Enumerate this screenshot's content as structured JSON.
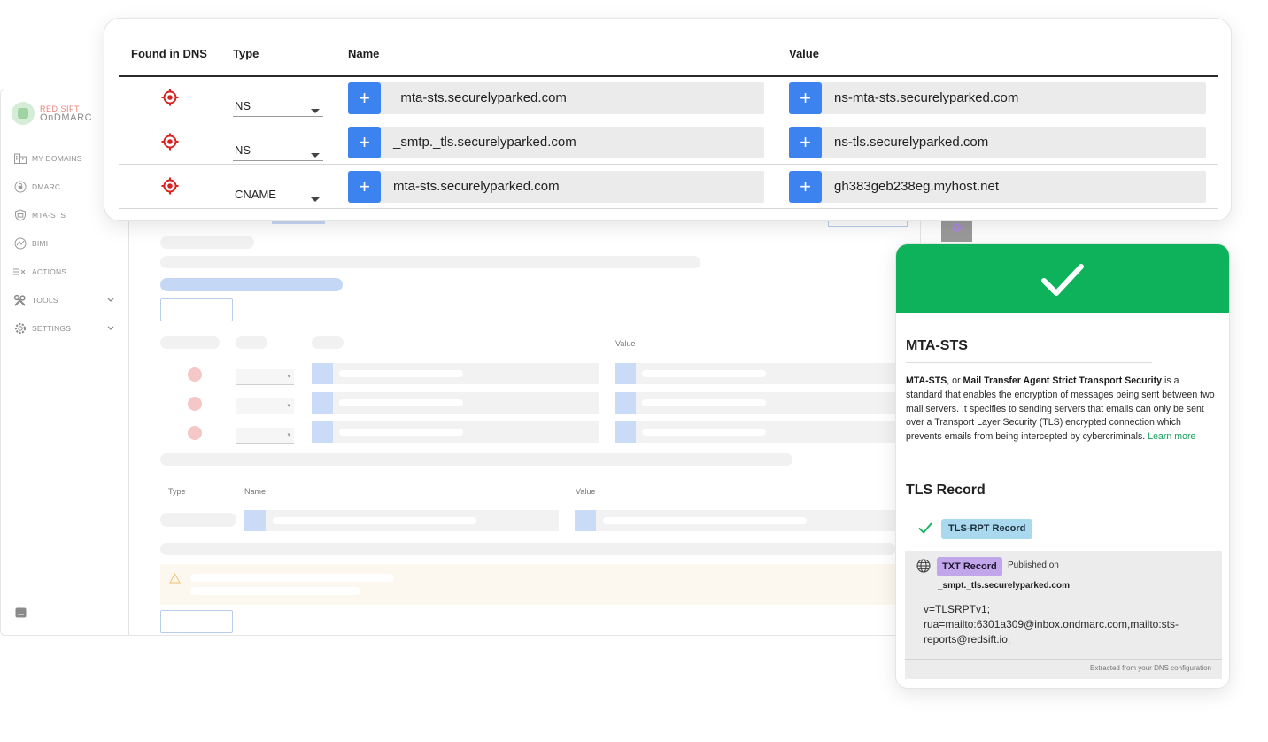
{
  "app": {
    "logo": {
      "line1": "RED SIFT",
      "line2": "OnDMARC"
    },
    "nav": [
      {
        "label": "MY DOMAINS",
        "icon": "building-icon"
      },
      {
        "label": "DMARC",
        "icon": "shield-lock-icon"
      },
      {
        "label": "MTA-STS",
        "icon": "shield-mail-icon"
      },
      {
        "label": "BIMI",
        "icon": "bimi-icon"
      },
      {
        "label": "ACTIONS",
        "icon": "actions-icon"
      },
      {
        "label": "TOOLS",
        "icon": "tools-icon"
      },
      {
        "label": "SETTINGS",
        "icon": "gear-icon"
      }
    ],
    "bg_table1": {
      "value_header": "Value"
    },
    "bg_table2": {
      "type_header": "Type",
      "name_header": "Name",
      "value_header": "Value"
    }
  },
  "dns": {
    "headers": {
      "found": "Found in DNS",
      "type": "Type",
      "name": "Name",
      "value": "Value"
    },
    "rows": [
      {
        "type": "NS",
        "name": "_mta-sts.securelyparked.com",
        "value": "ns-mta-sts.securelyparked.com"
      },
      {
        "type": "NS",
        "name": "_smtp._tls.securelyparked.com",
        "value": "ns-tls.securelyparked.com"
      },
      {
        "type": "CNAME",
        "name": "mta-sts.securelyparked.com",
        "value": "gh383geb238eg.myhost.net"
      }
    ]
  },
  "info": {
    "accent": "#0db25a",
    "mta_title": "MTA-STS",
    "desc_b1": "MTA-STS",
    "desc_t1": ", or ",
    "desc_b2": "Mail Transfer Agent Strict Transport Security",
    "desc_t2": " is a standard that enables the encryption of messages being sent between two mail servers. It specifies to sending servers that emails can only be sent over a Transport Layer Security (TLS) encrypted connection which prevents emails from being intercepted by cybercriminals. ",
    "learn_more": "Learn more",
    "tls_title": "TLS Record",
    "tls_badge": "TLS-RPT Record",
    "txt_badge": "TXT Record",
    "published_on": "Published on",
    "published_domain": "_smpt._tls.securelyparked.com",
    "record_value": "v=TLSRPTv1; rua=mailto:6301a309@inbox.ondmarc.com,mailto:sts-reports@redsift.io;",
    "footer": "Extracted from your DNS configuration"
  }
}
